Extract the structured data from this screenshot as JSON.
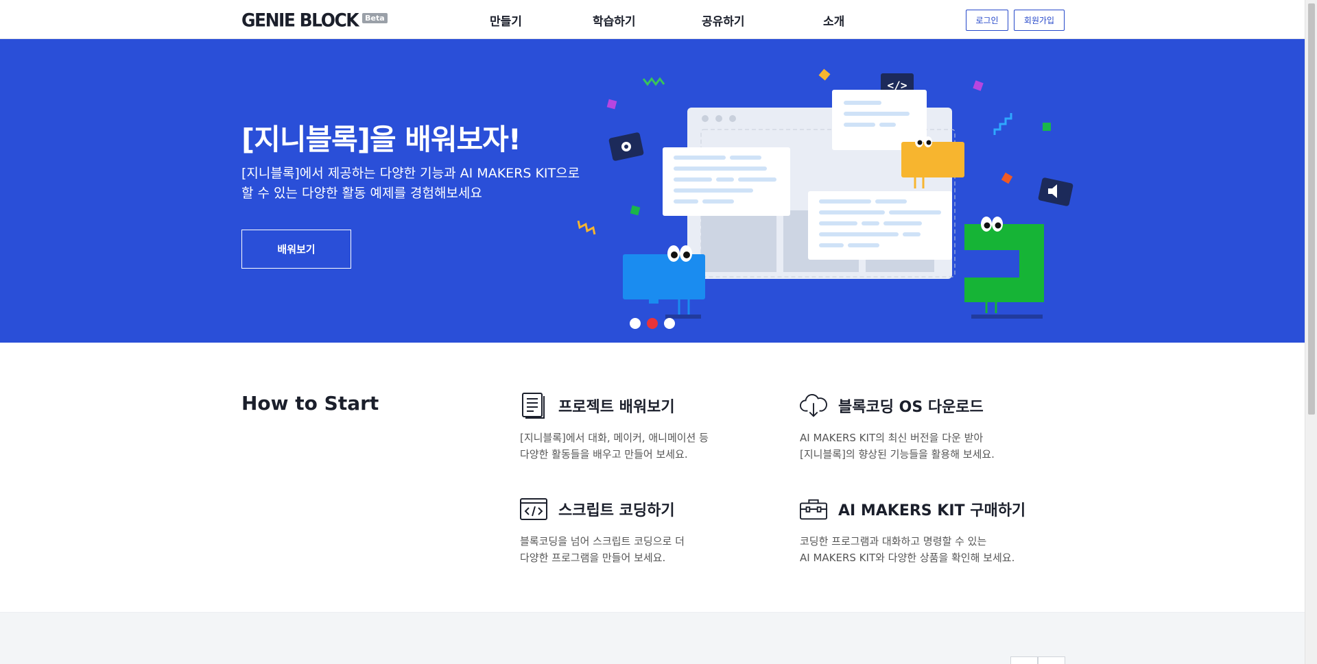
{
  "header": {
    "logo_text": "GENIE BLOCK",
    "logo_badge": "Beta",
    "nav": [
      {
        "label": "만들기"
      },
      {
        "label": "학습하기"
      },
      {
        "label": "공유하기"
      },
      {
        "label": "소개"
      }
    ],
    "login_label": "로그인",
    "signup_label": "회원가입"
  },
  "hero": {
    "title": "[지니블록]을 배워보자!",
    "desc_line1": "[지니블록]에서 제공하는 다양한 기능과 AI MAKERS KIT으로",
    "desc_line2": "할 수 있는 다양한 활동 예제를 경험해보세요",
    "button_label": "배워보기",
    "background": "#2a4fd8",
    "carousel": {
      "count": 3,
      "active_index": 2
    }
  },
  "how_to_start": {
    "title": "How to Start",
    "cards": [
      {
        "icon": "document-icon",
        "title": "프로젝트 배워보기",
        "desc_line1": "[지니블록]에서 대화, 메이커, 애니메이션 등",
        "desc_line2": "다양한 활동들을 배우고 만들어 보세요."
      },
      {
        "icon": "cloud-download-icon",
        "title": "블록코딩 OS 다운로드",
        "desc_line1": "AI MAKERS KIT의 최신 버전을 다운 받아",
        "desc_line2": "[지니블록]의 향상된 기능들을 활용해 보세요."
      },
      {
        "icon": "code-window-icon",
        "title": "스크립트 코딩하기",
        "desc_line1": "블록코딩을 넘어 스크립트 코딩으로 더",
        "desc_line2": "다양한 프로그램을 만들어 보세요."
      },
      {
        "icon": "toolbox-icon",
        "title": "AI MAKERS KIT 구매하기",
        "desc_line1": "코딩한 프로그램과 대화하고 명령할 수 있는",
        "desc_line2": "AI MAKERS KIT와 다양한 상품을 확인해 보세요."
      }
    ]
  },
  "colors": {
    "accent": "#2346c9",
    "hero_bg": "#2a4fd8",
    "active_dot": "#e8343a"
  }
}
